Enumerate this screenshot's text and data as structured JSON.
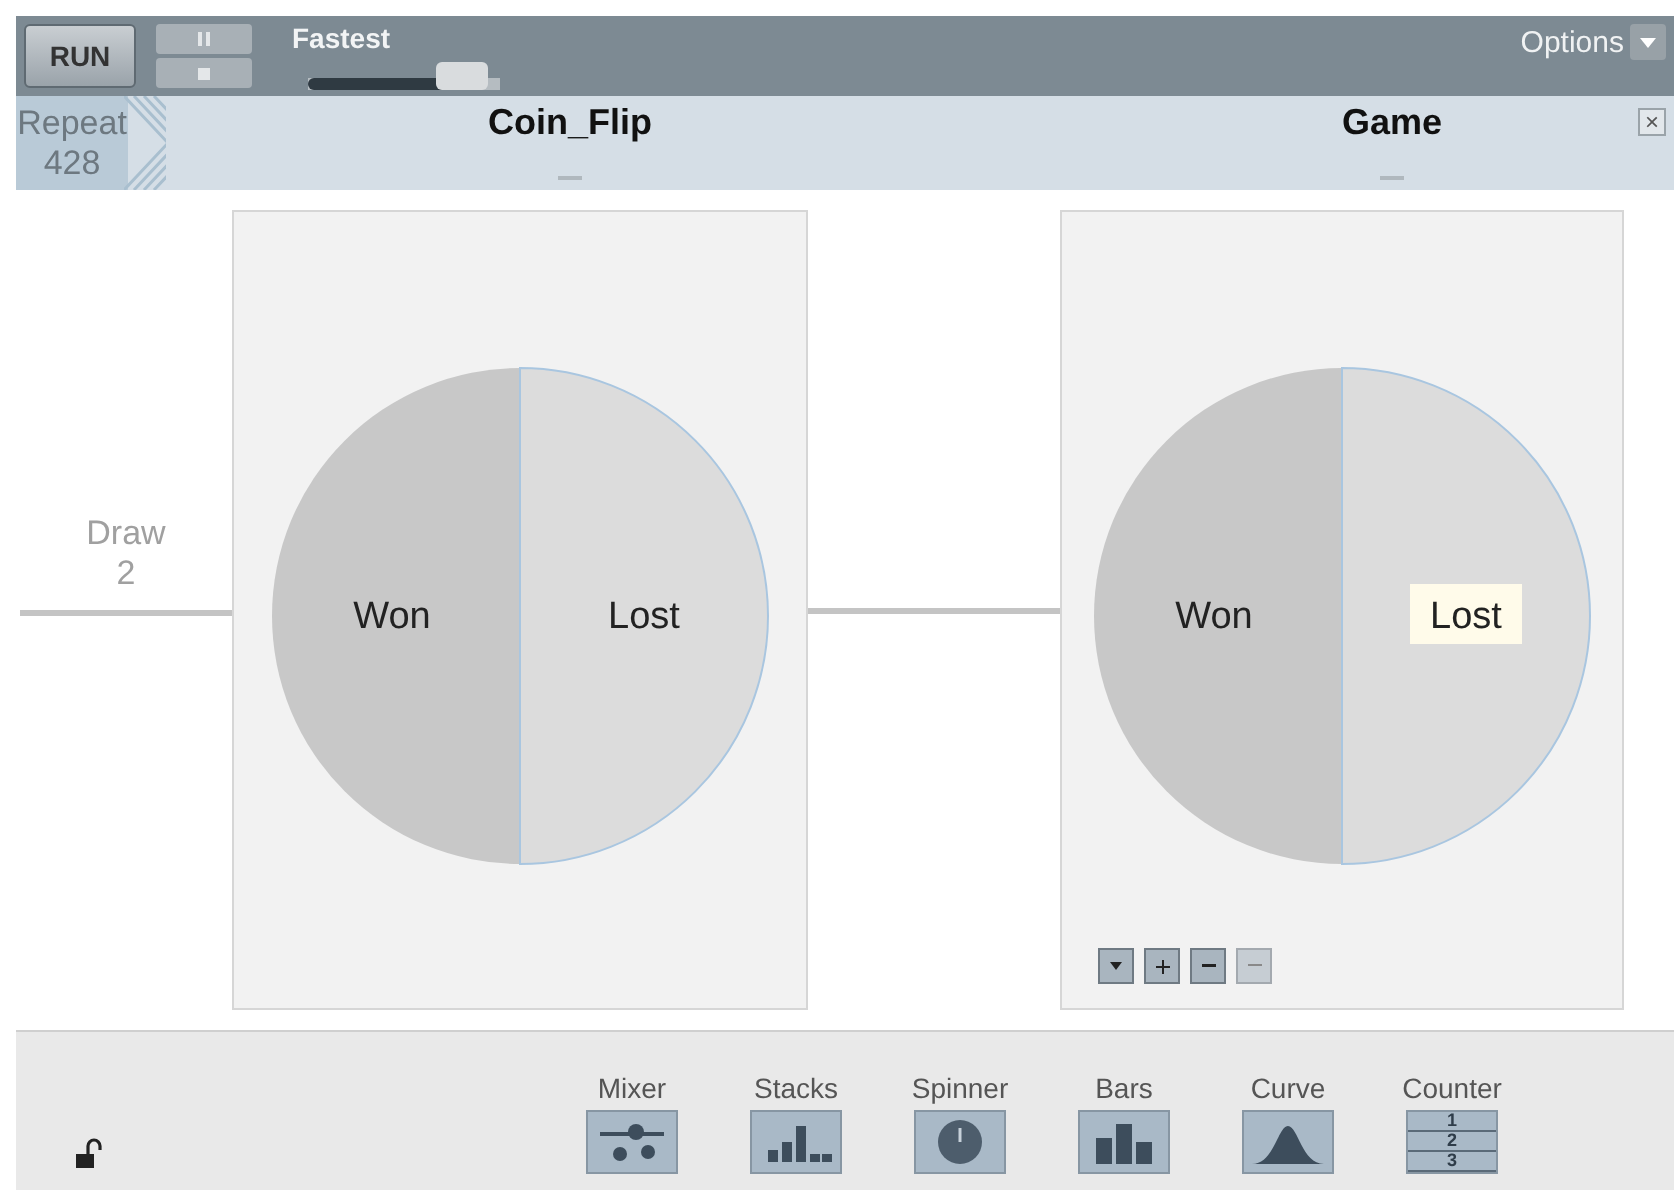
{
  "toolbar": {
    "run": "RUN",
    "speed": {
      "label": "Fastest",
      "level": 0.8
    },
    "options": "Options"
  },
  "header": {
    "repeat_label": "Repeat",
    "repeat_count": "428",
    "devices": [
      {
        "title": "Coin_Flip"
      },
      {
        "title": "Game"
      }
    ],
    "close": "×"
  },
  "draw": {
    "label": "Draw",
    "count": "2"
  },
  "devices": [
    {
      "kind": "spinner",
      "segments": [
        {
          "label": "Won",
          "highlighted": false
        },
        {
          "label": "Lost",
          "highlighted": false
        }
      ],
      "controls": false
    },
    {
      "kind": "spinner",
      "segments": [
        {
          "label": "Won",
          "highlighted": false
        },
        {
          "label": "Lost",
          "highlighted": true
        }
      ],
      "controls": true
    }
  ],
  "palette": [
    {
      "kind": "mixer",
      "label": "Mixer"
    },
    {
      "kind": "stacks",
      "label": "Stacks"
    },
    {
      "kind": "spinner",
      "label": "Spinner"
    },
    {
      "kind": "bars",
      "label": "Bars"
    },
    {
      "kind": "curve",
      "label": "Curve"
    },
    {
      "kind": "counter",
      "label": "Counter",
      "digits": [
        "1",
        "2",
        "3"
      ]
    }
  ]
}
